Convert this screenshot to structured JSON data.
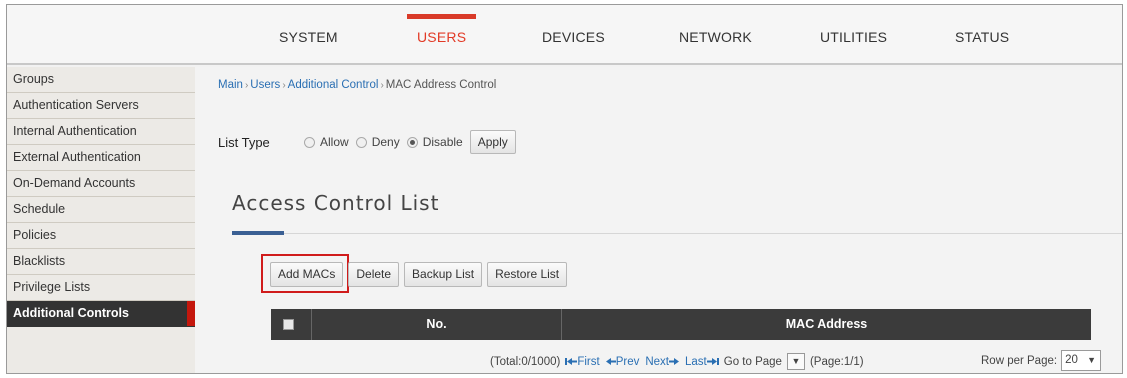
{
  "topnav": {
    "tabs": [
      {
        "label": "SYSTEM",
        "active": false
      },
      {
        "label": "USERS",
        "active": true
      },
      {
        "label": "DEVICES",
        "active": false
      },
      {
        "label": "NETWORK",
        "active": false
      },
      {
        "label": "UTILITIES",
        "active": false
      },
      {
        "label": "STATUS",
        "active": false
      }
    ]
  },
  "sidebar": {
    "items": [
      {
        "label": "Groups"
      },
      {
        "label": "Authentication Servers"
      },
      {
        "label": "Internal Authentication"
      },
      {
        "label": "External Authentication"
      },
      {
        "label": "On-Demand Accounts"
      },
      {
        "label": "Schedule"
      },
      {
        "label": "Policies"
      },
      {
        "label": "Blacklists"
      },
      {
        "label": "Privilege Lists"
      },
      {
        "label": "Additional Controls",
        "active": true
      }
    ]
  },
  "breadcrumb": {
    "items": [
      "Main",
      "Users",
      "Additional Control",
      "MAC Address Control"
    ],
    "separator": "›"
  },
  "list_type": {
    "label": "List Type",
    "options": [
      {
        "label": "Allow",
        "selected": false
      },
      {
        "label": "Deny",
        "selected": false
      },
      {
        "label": "Disable",
        "selected": true
      }
    ],
    "apply_label": "Apply"
  },
  "section": {
    "title": "Access Control List"
  },
  "actions": {
    "add_label": "Add MACs",
    "delete_label": "Delete",
    "backup_label": "Backup List",
    "restore_label": "Restore List"
  },
  "table": {
    "columns": [
      "No.",
      "MAC Address"
    ],
    "rows": []
  },
  "pager": {
    "total": "(Total:0/1000)",
    "first_icon": "first-page-icon",
    "first": "First",
    "prev_icon": "prev-page-icon",
    "prev": "Prev",
    "next": "Next",
    "next_icon": "next-page-icon",
    "last": "Last",
    "last_icon": "last-page-icon",
    "goto_label": "Go to Page",
    "page_info": "(Page:1/1)",
    "rows_label": "Row per Page:",
    "rows_value": "20"
  },
  "colors": {
    "active_tab": "#e23a26",
    "sidebar_active_bg": "#333333",
    "sidebar_active_marker": "#c4170d",
    "table_header": "#3b3b3b",
    "link": "#2a6fb3",
    "highlight_box": "#d01b1b",
    "section_accent": "#3a5f93"
  }
}
